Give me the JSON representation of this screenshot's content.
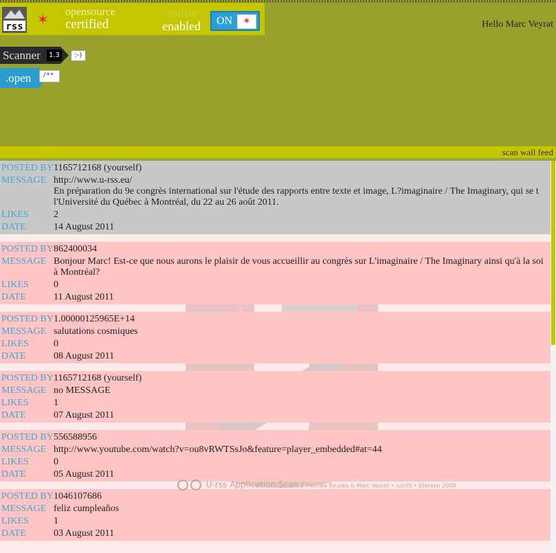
{
  "header": {
    "logo_text": "rss",
    "opensource_top": "opensource",
    "opensource_bottom": "certified",
    "sniffer_top": "sniffer",
    "sniffer_bottom": "enabled",
    "toggle_label": "ON",
    "greeting": "Hello Marc Veyrat"
  },
  "scanner": {
    "label": "Scanner",
    "version": "1.3",
    "mood": ":-)"
  },
  "open": {
    "label": ".open",
    "comment": "/**"
  },
  "feed_bar": {
    "label": "scan wall feed"
  },
  "field_labels": {
    "posted_by": "POSTED BY",
    "message": "MESSAGE",
    "likes": "LIKES",
    "date": "DATE"
  },
  "posts": [
    {
      "posted_by": "1165712168 (yourself)",
      "message_line1": "http://www.u-rss.eu/",
      "message_line2": "En préparation du 9e congrès international sur l'étude des rapports entre texte et image, L?imaginaire / The Imaginary, qui se t",
      "message_line3": "l'Université du Québec à Montréal, du 22 au 26 août 2011.",
      "likes": "2",
      "date": "14 August 2011"
    },
    {
      "posted_by": "862400034",
      "message_line1": "Bonjour Marc! Est-ce que nous aurons le plaisir de vous accueillir au congrès sur L'imaginaire / The Imaginary ainsi qu'à la soi",
      "message_line2": "à Montréal?",
      "likes": "0",
      "date": "11 August 2011"
    },
    {
      "posted_by": "1.00000125965E+14",
      "message_line1": "salutations cosmiques",
      "likes": "0",
      "date": "08 August 2011"
    },
    {
      "posted_by": "1165712168 (yourself)",
      "message_line1": "no MESSAGE",
      "likes": "1",
      "date": "07 August 2011"
    },
    {
      "posted_by": "556588956",
      "message_line1": "http://www.youtube.com/watch?v=ou8vRWTSsJo&feature=player_embedded#at=44",
      "likes": "0",
      "date": "05 August 2011"
    },
    {
      "posted_by": "1046107686",
      "message_line1": "feliz cumpleaños",
      "likes": "1",
      "date": "03 August 2011"
    }
  ],
  "credit": {
    "main": "U-rss Application Scan /",
    "small": "Pascale Boulais & Marc Veyrat • sociIS • Eteraen 2008"
  },
  "colors": {
    "header_bg": "#99a12d",
    "brand_bar": "#c4c700",
    "label_blue": "#43a6d8",
    "post_pink": "#ffc4c4",
    "post_grey": "#c8c8c8",
    "star_red": "#e8262c"
  }
}
